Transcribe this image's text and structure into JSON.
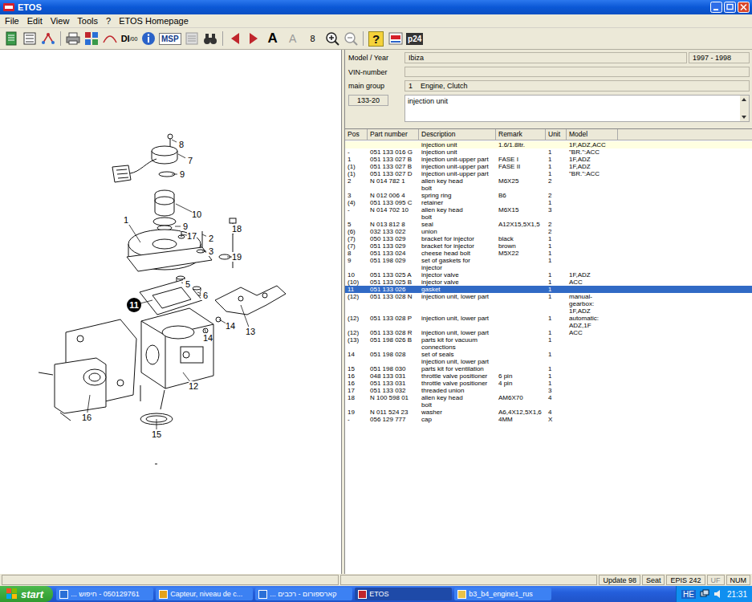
{
  "window": {
    "title": "ETOS"
  },
  "menu": [
    "File",
    "Edit",
    "View",
    "Tools",
    "?",
    "ETOS Homepage"
  ],
  "toolbar": {
    "di": "DI",
    "di_sub": "/00",
    "msp": "MSP",
    "font_large": "A",
    "font_small": "A",
    "size": "8",
    "help": "?",
    "p24": "p24"
  },
  "form": {
    "model_label": "Model / Year",
    "model_value": "Ibiza",
    "year_value": "1997 - 1998",
    "vin_label": "VIN-number",
    "vin_value": "",
    "group_label": "main group",
    "group_number": "1",
    "group_value": "Engine, Clutch",
    "sub_code": "133-20",
    "sub_value": "injection unit"
  },
  "diagram": {
    "callouts": [
      {
        "label": "8",
        "selected": false
      },
      {
        "label": "7",
        "selected": false
      },
      {
        "label": "9",
        "selected": false
      },
      {
        "label": "1",
        "selected": false
      },
      {
        "label": "10",
        "selected": false
      },
      {
        "label": "9",
        "selected": false
      },
      {
        "label": "17",
        "selected": false
      },
      {
        "label": "2",
        "selected": false
      },
      {
        "label": "18",
        "selected": false
      },
      {
        "label": "3",
        "selected": false
      },
      {
        "label": "19",
        "selected": false
      },
      {
        "label": "5",
        "selected": false
      },
      {
        "label": "6",
        "selected": false
      },
      {
        "label": "11",
        "selected": true
      },
      {
        "label": "13",
        "selected": false
      },
      {
        "label": "14",
        "selected": false
      },
      {
        "label": "14",
        "selected": false
      },
      {
        "label": "12",
        "selected": false
      },
      {
        "label": "16",
        "selected": false
      },
      {
        "label": "15",
        "selected": false
      }
    ]
  },
  "table": {
    "columns": [
      "Pos",
      "Part number",
      "Description",
      "Remark",
      "Unit",
      "Model"
    ],
    "rows": [
      {
        "kind": "heading",
        "selected": false,
        "pos": "",
        "part": "",
        "desc": [
          "injection unit"
        ],
        "remark": "1.6/1.8ltr.",
        "unit": "",
        "model": [
          "1F,ADZ,ACC"
        ]
      },
      {
        "kind": "part",
        "selected": false,
        "pos": "-",
        "part": "051 133 016 G",
        "desc": [
          "injection unit"
        ],
        "remark": "",
        "unit": "1",
        "model": [
          "\"BR.\":ACC"
        ]
      },
      {
        "kind": "part",
        "selected": false,
        "pos": "1",
        "part": "051 133 027 B",
        "desc": [
          "injection unit-upper part"
        ],
        "remark": "FASE I",
        "unit": "1",
        "model": [
          "1F,ADZ"
        ]
      },
      {
        "kind": "part",
        "selected": false,
        "pos": "(1)",
        "part": "051 133 027 B",
        "desc": [
          "injection unit-upper part"
        ],
        "remark": "FASE II",
        "unit": "1",
        "model": [
          "1F,ADZ"
        ]
      },
      {
        "kind": "part",
        "selected": false,
        "pos": "(1)",
        "part": "051 133 027 D",
        "desc": [
          "injection unit-upper part"
        ],
        "remark": "",
        "unit": "1",
        "model": [
          "\"BR.\":ACC"
        ]
      },
      {
        "kind": "part",
        "selected": false,
        "pos": "2",
        "part": "N 014 782 1",
        "desc": [
          "allen key head",
          "bolt"
        ],
        "remark": "M6X25",
        "unit": "2",
        "model": []
      },
      {
        "kind": "part",
        "selected": false,
        "pos": "3",
        "part": "N 012 006 4",
        "desc": [
          "spring ring"
        ],
        "remark": "B6",
        "unit": "2",
        "model": []
      },
      {
        "kind": "part",
        "selected": false,
        "pos": "(4)",
        "part": "051 133 095 C",
        "desc": [
          "retainer"
        ],
        "remark": "",
        "unit": "1",
        "model": []
      },
      {
        "kind": "part",
        "selected": false,
        "pos": "-",
        "part": "N 014 702 10",
        "desc": [
          "allen key head",
          "bolt"
        ],
        "remark": "M6X15",
        "unit": "3",
        "model": []
      },
      {
        "kind": "part",
        "selected": false,
        "pos": "5",
        "part": "N 013 812 8",
        "desc": [
          "seal"
        ],
        "remark": "A12X15,5X1,5",
        "unit": "2",
        "model": []
      },
      {
        "kind": "part",
        "selected": false,
        "pos": "(6)",
        "part": "032 133 022",
        "desc": [
          "union"
        ],
        "remark": "",
        "unit": "2",
        "model": []
      },
      {
        "kind": "part",
        "selected": false,
        "pos": "(7)",
        "part": "050 133 029",
        "desc": [
          "bracket for injector"
        ],
        "remark": "black",
        "unit": "1",
        "model": []
      },
      {
        "kind": "part",
        "selected": false,
        "pos": "(7)",
        "part": "051 133 029",
        "desc": [
          "bracket for injector"
        ],
        "remark": "brown",
        "unit": "1",
        "model": []
      },
      {
        "kind": "part",
        "selected": false,
        "pos": "8",
        "part": "051 133 024",
        "desc": [
          "cheese head bolt"
        ],
        "remark": "M5X22",
        "unit": "1",
        "model": []
      },
      {
        "kind": "part",
        "selected": false,
        "pos": "9",
        "part": "051 198 029",
        "desc": [
          "set of gaskets for",
          "injector"
        ],
        "remark": "",
        "unit": "1",
        "model": []
      },
      {
        "kind": "part",
        "selected": false,
        "pos": "10",
        "part": "051 133 025 A",
        "desc": [
          "injector valve"
        ],
        "remark": "",
        "unit": "1",
        "model": [
          "1F,ADZ"
        ]
      },
      {
        "kind": "part",
        "selected": false,
        "pos": "(10)",
        "part": "051 133 025 B",
        "desc": [
          "injector valve"
        ],
        "remark": "",
        "unit": "1",
        "model": [
          "ACC"
        ]
      },
      {
        "kind": "part",
        "selected": true,
        "pos": "11",
        "part": "051 133 026",
        "desc": [
          "gasket"
        ],
        "remark": "",
        "unit": "1",
        "model": []
      },
      {
        "kind": "part",
        "selected": false,
        "pos": "(12)",
        "part": "051 133 028 N",
        "desc": [
          "injection unit, lower part"
        ],
        "remark": "",
        "unit": "1",
        "model": [
          "manual-",
          "gearbox:",
          "1F,ADZ"
        ]
      },
      {
        "kind": "part",
        "selected": false,
        "pos": "(12)",
        "part": "051 133 028 P",
        "desc": [
          "injection unit, lower part"
        ],
        "remark": "",
        "unit": "1",
        "model": [
          "automatic:",
          "ADZ,1F"
        ]
      },
      {
        "kind": "part",
        "selected": false,
        "pos": "(12)",
        "part": "051 133 028 R",
        "desc": [
          "injection unit, lower part"
        ],
        "remark": "",
        "unit": "1",
        "model": [
          "ACC"
        ]
      },
      {
        "kind": "part",
        "selected": false,
        "pos": "(13)",
        "part": "051 198 026 B",
        "desc": [
          "parts kit for vacuum",
          "connections"
        ],
        "remark": "",
        "unit": "1",
        "model": []
      },
      {
        "kind": "part",
        "selected": false,
        "pos": "14",
        "part": "051 198 028",
        "desc": [
          "set of seals",
          "injection unit, lower part"
        ],
        "remark": "",
        "unit": "1",
        "model": []
      },
      {
        "kind": "part",
        "selected": false,
        "pos": "15",
        "part": "051 198 030",
        "desc": [
          "parts kit for ventilation"
        ],
        "remark": "",
        "unit": "1",
        "model": []
      },
      {
        "kind": "part",
        "selected": false,
        "pos": "16",
        "part": "048 133 031",
        "desc": [
          "throttle valve positioner"
        ],
        "remark": "6 pin",
        "unit": "1",
        "model": []
      },
      {
        "kind": "part",
        "selected": false,
        "pos": "16",
        "part": "051 133 031",
        "desc": [
          "throttle valve positioner"
        ],
        "remark": "4 pin",
        "unit": "1",
        "model": []
      },
      {
        "kind": "part",
        "selected": false,
        "pos": "17",
        "part": "051 133 032",
        "desc": [
          "threaded union"
        ],
        "remark": "",
        "unit": "3",
        "model": []
      },
      {
        "kind": "part",
        "selected": false,
        "pos": "18",
        "part": "N 100 598 01",
        "desc": [
          "allen key head",
          "bolt"
        ],
        "remark": "AM6X70",
        "unit": "4",
        "model": []
      },
      {
        "kind": "part",
        "selected": false,
        "pos": "19",
        "part": "N 011 524 23",
        "desc": [
          "washer"
        ],
        "remark": "A6,4X12,5X1,6",
        "unit": "4",
        "model": []
      },
      {
        "kind": "part",
        "selected": false,
        "pos": "-",
        "part": "056 129 777",
        "desc": [
          "cap"
        ],
        "remark": "4MM",
        "unit": "X",
        "model": []
      }
    ]
  },
  "status_bar": [
    {
      "text": "Update 98",
      "active": true
    },
    {
      "text": "Seat",
      "active": true
    },
    {
      "text": "EPIS 242",
      "active": true
    },
    {
      "text": "UF",
      "active": false
    },
    {
      "text": "NUM",
      "active": true
    }
  ],
  "taskbar": {
    "start": "start",
    "tasks": [
      {
        "label": "050129761 - חיפוש ...",
        "selected": false
      },
      {
        "label": "Capteur, niveau de c...",
        "selected": false
      },
      {
        "label": "קארספורום - רכבים ...",
        "selected": false
      },
      {
        "label": "ETOS",
        "selected": true
      },
      {
        "label": "b3_b4_engine1_rus",
        "selected": false
      }
    ],
    "language": "HE",
    "time": "21:31"
  }
}
